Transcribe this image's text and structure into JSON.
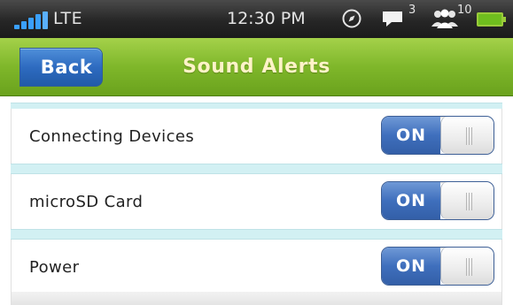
{
  "status_bar": {
    "carrier": "LTE",
    "time": "12:30 PM",
    "messages_count": "3",
    "people_count": "10",
    "icons": [
      "signal-icon",
      "compass-icon",
      "message-icon",
      "people-icon",
      "battery-icon"
    ]
  },
  "header": {
    "back_label": "Back",
    "title": "Sound Alerts"
  },
  "settings": [
    {
      "label": "Connecting Devices",
      "state": "ON"
    },
    {
      "label": "microSD Card",
      "state": "ON"
    },
    {
      "label": "Power",
      "state": "ON"
    }
  ],
  "colors": {
    "header_green": "#7fb72a",
    "accent_blue": "#3f6fbd",
    "divider_cyan": "#d2f0f3"
  }
}
